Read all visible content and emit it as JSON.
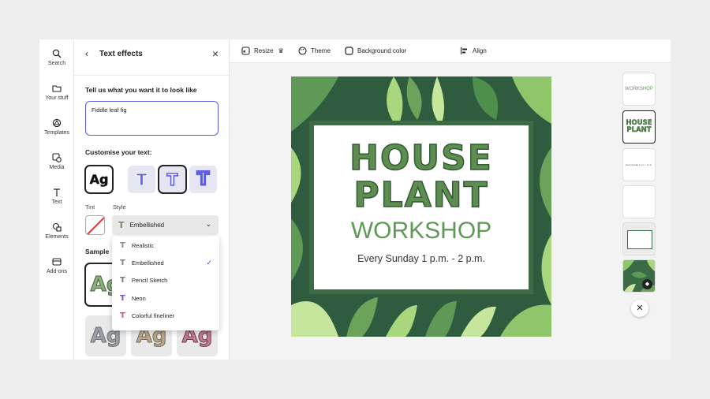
{
  "rail": [
    {
      "label": "Search",
      "icon": "search-icon"
    },
    {
      "label": "Your stuff",
      "icon": "folder-icon"
    },
    {
      "label": "Templates",
      "icon": "templates-icon"
    },
    {
      "label": "Media",
      "icon": "media-icon"
    },
    {
      "label": "Text",
      "icon": "text-icon"
    },
    {
      "label": "Elements",
      "icon": "elements-icon"
    },
    {
      "label": "Add-ons",
      "icon": "addons-icon"
    }
  ],
  "panel": {
    "title": "Text effects",
    "prompt_heading": "Tell us what you want it to look like",
    "prompt_value": "Fiddle leaf fig",
    "customise_heading": "Customise your text:",
    "tint_label": "Tint",
    "style_label": "Style",
    "style_selected": "Embellished",
    "sample_heading": "Sample",
    "effect_preview_text": "Ag",
    "effect_glyph": "T",
    "sample_text": "Ag"
  },
  "style_menu": [
    {
      "label": "Realistic",
      "selected": false
    },
    {
      "label": "Embellished",
      "selected": true
    },
    {
      "label": "Pencil Sketch",
      "selected": false
    },
    {
      "label": "Neon",
      "selected": false
    },
    {
      "label": "Colorful fineliner",
      "selected": false
    }
  ],
  "toolbar": {
    "resize": "Resize",
    "theme": "Theme",
    "background_color": "Background color",
    "align": "Align"
  },
  "design": {
    "line1": "HOUSE",
    "line2": "PLANT",
    "line3": "WORKSHOP",
    "line4": "Every Sunday 1 p.m. - 2 p.m."
  },
  "thumbnails": {
    "t1": "WORKSHOP",
    "t2a": "HOUSE",
    "t2b": "PLANT",
    "t3": "Every Sunday 1 p.m. - 2 p.m."
  },
  "colors": {
    "accent": "#5c5ce0",
    "forest": "#2f5c3f",
    "leaf_light": "#a8d77e",
    "workshop_green": "#5e9a56",
    "check_blue": "#3b52d6"
  }
}
